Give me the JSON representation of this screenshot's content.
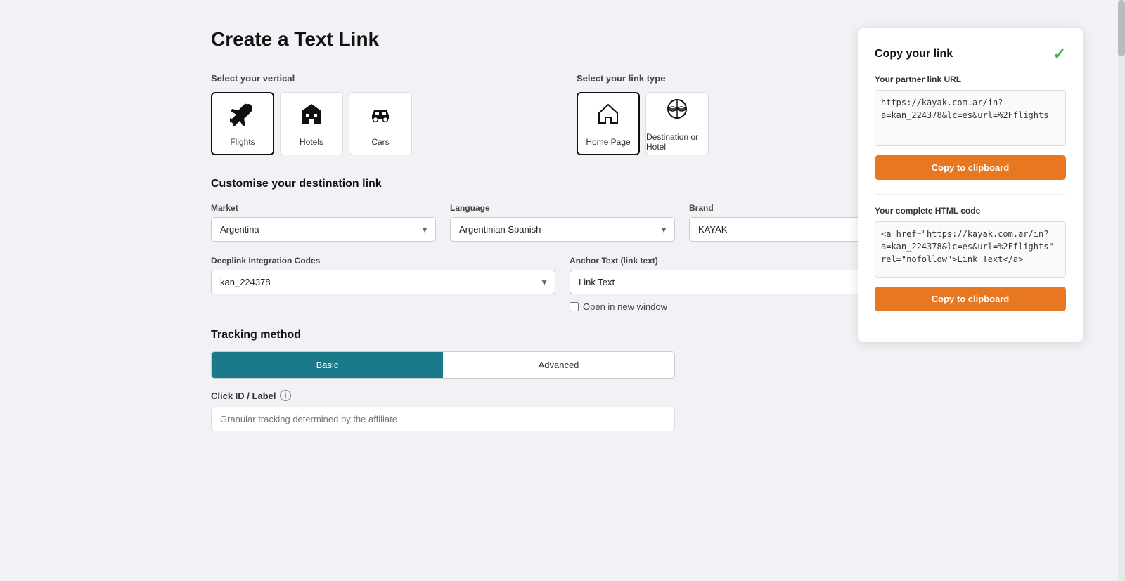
{
  "page": {
    "title": "Create a Text Link",
    "vertical_section_label": "Select your vertical",
    "link_type_section_label": "Select your link type"
  },
  "verticals": [
    {
      "id": "flights",
      "label": "Flights",
      "icon": "✈",
      "selected": true
    },
    {
      "id": "hotels",
      "label": "Hotels",
      "icon": "🏨",
      "selected": false
    },
    {
      "id": "cars",
      "label": "Cars",
      "icon": "🚗",
      "selected": false
    }
  ],
  "link_types": [
    {
      "id": "homepage",
      "label": "Home Page",
      "icon": "🏠",
      "selected": true
    },
    {
      "id": "destination",
      "label": "Destination or Hotel",
      "icon": "🌐",
      "selected": false
    }
  ],
  "customise": {
    "title": "Customise your destination link",
    "market_label": "Market",
    "market_value": "Argentina",
    "language_label": "Language",
    "language_value": "Argentinian Spanish",
    "brand_label": "Brand",
    "brand_value": "KAYAK",
    "deeplink_label": "Deeplink Integration Codes",
    "deeplink_value": "kan_224378",
    "anchor_label": "Anchor Text (link text)",
    "anchor_value": "Link Text",
    "open_new_window_label": "Open in new window"
  },
  "tracking": {
    "title": "Tracking method",
    "basic_label": "Basic",
    "advanced_label": "Advanced",
    "click_id_label": "Click ID / Label",
    "click_id_placeholder": "Granular tracking determined by the affiliate"
  },
  "copy_panel": {
    "title": "Copy your link",
    "partner_url_label": "Your partner link URL",
    "partner_url": "https://kayak.com.ar/in?\na=kan_224378&lc=es&url=%2Fflights",
    "copy_btn_1": "Copy to clipboard",
    "html_code_label": "Your complete HTML code",
    "html_code": "<a href=\"https://kayak.com.ar/in?\na=kan_224378&lc=es&url=%2Fflights\"\nrel=\"nofollow\">Link Text</a>",
    "copy_btn_2": "Copy to clipboard"
  }
}
